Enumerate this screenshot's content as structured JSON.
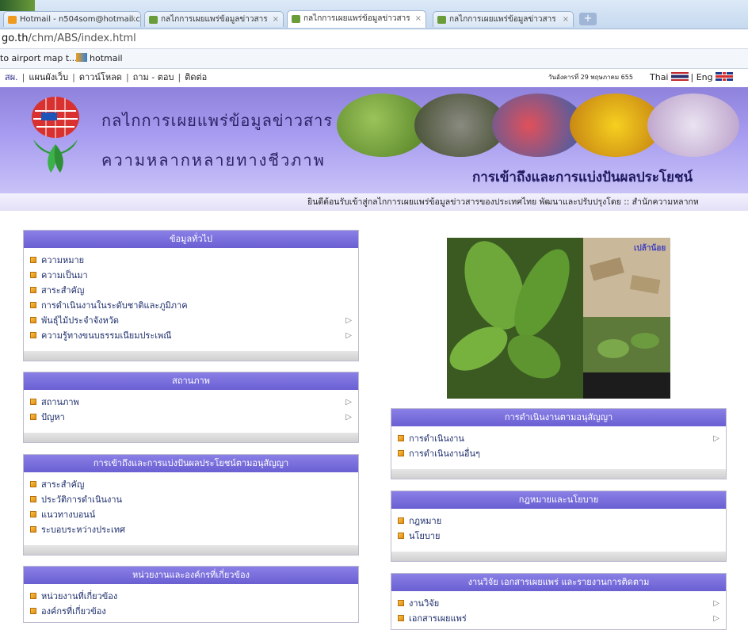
{
  "browser": {
    "tabs": [
      {
        "label": "Hotmail - n504som@hotmail.cc"
      },
      {
        "label": "กลไกการเผยแพร่ข้อมูลข่าวสาร"
      },
      {
        "label": "กลไกการเผยแพร่ข้อมูลข่าวสาร"
      },
      {
        "label": "กลไกการเผยแพร่ข้อมูลข่าวสาร"
      }
    ],
    "newtab": "+",
    "close": "×",
    "url_prefix": "go.th",
    "url_path": "/chm/ABS/index.html",
    "favorites": [
      "to airport map t...",
      "hotmail"
    ]
  },
  "site": {
    "nav": [
      "สผ.",
      "แผนผังเว็บ",
      "ดาวน์โหลด",
      "ถาม - ตอบ",
      "ติดต่อ"
    ],
    "nav_sep": "|",
    "date": "วันอังคารที่ 29 พฤษภาคม 655",
    "lang_thai": "Thai",
    "lang_sep": "|",
    "lang_eng": "Eng",
    "title_line1": "กลไกการเผยแพร่ข้อมูลข่าวสาร",
    "title_line2": "ความหลากหลายทางชีวภาพ",
    "slogan": "การเข้าถึงและการแบ่งปันผลประโยชน์",
    "marquee": "ยินดีต้อนรับเข้าสู่กลไกการเผยแพร่ข้อมูลข่าวสารของประเทศไทย พัฒนาและปรับปรุงโดย :: สำนักความหลากห",
    "photo_caption": "เปล้าน้อย"
  },
  "panels": {
    "general": {
      "title": "ข้อมูลทั่วไป",
      "items": [
        {
          "label": "ความหมาย",
          "arrow": ""
        },
        {
          "label": "ความเป็นมา",
          "arrow": ""
        },
        {
          "label": "สาระสำคัญ",
          "arrow": ""
        },
        {
          "label": "การดำเนินงานในระดับชาติและภูมิภาค",
          "arrow": ""
        },
        {
          "label": "พันธุ์ไม้ประจำจังหวัด",
          "arrow": "▷"
        },
        {
          "label": "ความรู้ทางขนบธรรมเนียมประเพณี",
          "arrow": "▷"
        }
      ]
    },
    "status": {
      "title": "สถานภาพ",
      "items": [
        {
          "label": "สถานภาพ",
          "arrow": "▷"
        },
        {
          "label": "ปัญหา",
          "arrow": "▷"
        }
      ]
    },
    "access": {
      "title": "การเข้าถึงและการแบ่งปันผลประโยชน์ตามอนุสัญญา",
      "items": [
        {
          "label": "สาระสำคัญ",
          "arrow": ""
        },
        {
          "label": "ประวัติการดำเนินงาน",
          "arrow": ""
        },
        {
          "label": "แนวทางบอนน์",
          "arrow": ""
        },
        {
          "label": "ระบอบระหว่างประเทศ",
          "arrow": ""
        }
      ]
    },
    "agencies": {
      "title": "หน่วยงานและองค์กรที่เกี่ยวข้อง",
      "items": [
        {
          "label": "หน่วยงานที่เกี่ยวข้อง",
          "arrow": ""
        },
        {
          "label": "องค์กรที่เกี่ยวข้อง",
          "arrow": ""
        }
      ]
    },
    "convention": {
      "title": "การดำเนินงานตามอนุสัญญา",
      "items": [
        {
          "label": "การดำเนินงาน",
          "arrow": "▷"
        },
        {
          "label": "การดำเนินงานอื่นๆ",
          "arrow": ""
        }
      ]
    },
    "law": {
      "title": "กฎหมายและนโยบาย",
      "items": [
        {
          "label": "กฎหมาย",
          "arrow": ""
        },
        {
          "label": "นโยบาย",
          "arrow": ""
        }
      ]
    },
    "research": {
      "title": "งานวิจัย เอกสารเผยแพร่ และรายงานการติดตาม",
      "items": [
        {
          "label": "งานวิจัย",
          "arrow": "▷"
        },
        {
          "label": "เอกสารเผยแพร่",
          "arrow": "▷"
        }
      ]
    }
  }
}
